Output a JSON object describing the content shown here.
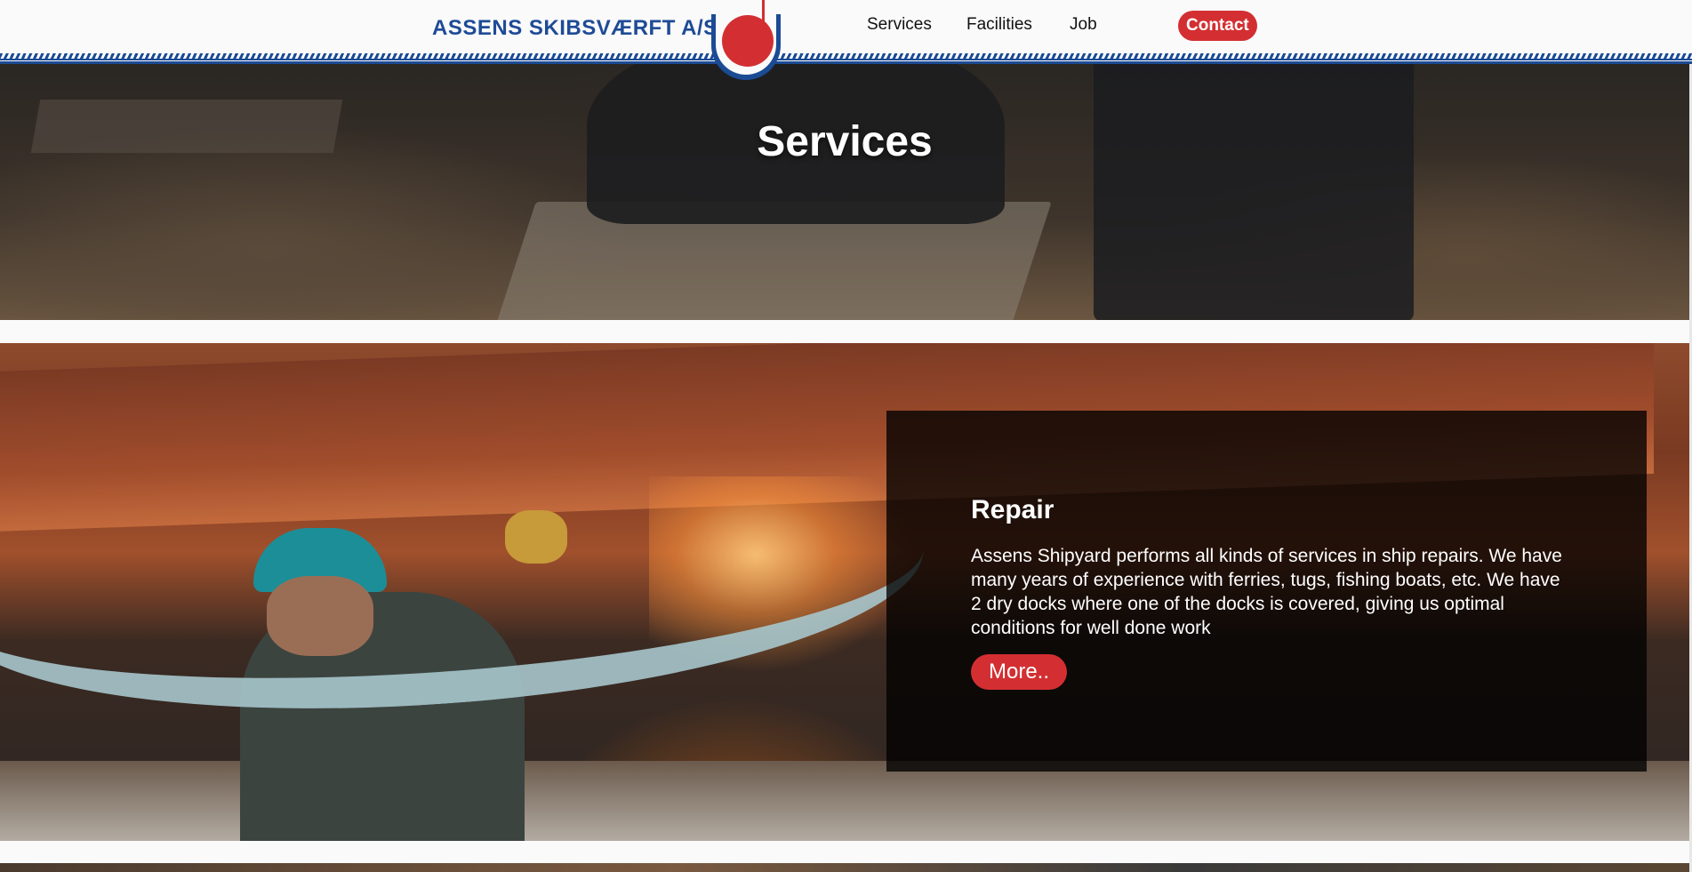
{
  "header": {
    "logo_text": "ASSENS SKIBSVÆRFT A/S",
    "nav": {
      "services": "Services",
      "facilities": "Facilities",
      "job": "Job",
      "contact": "Contact"
    }
  },
  "hero": {
    "title": "Services"
  },
  "repair": {
    "title": "Repair",
    "description": "Assens Shipyard performs all kinds of services in ship repairs. We have many years of experience with ferries, tugs, fishing boats, etc. We have 2 dry docks where one of the docks is covered, giving us optimal conditions for well done work",
    "button": "More.."
  },
  "colors": {
    "brand_blue": "#1e4b96",
    "accent_red": "#d32f32"
  }
}
